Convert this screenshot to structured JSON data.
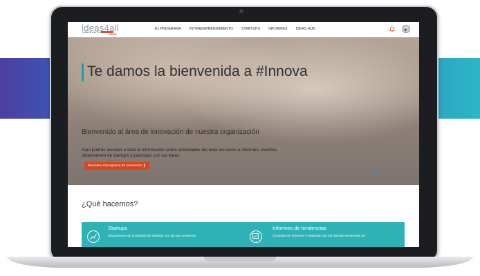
{
  "nav": {
    "logo": {
      "main": "ideas4all",
      "sub": "INNOVATION",
      "tag": "DEMO"
    },
    "links": [
      "EL PROGRAMA",
      "INTRAEMPRENDIMIENTO",
      "STARTUPS",
      "INFORMES",
      "IDEAS HUB"
    ]
  },
  "hero": {
    "title": "Te damos la bienvenida a #Innova",
    "subtitle": "Bienvenido al área de innovación de nuestra organización",
    "description": "Aquí podrás acceder a toda la información sobre actividades del área así como a informes, eventos, observatorio de startups y participar con tus ideas",
    "button_label": "Descubre el programa de innovación ❯"
  },
  "section": {
    "title": "¿Qué hacemos?"
  },
  "cards": [
    {
      "title": "Startups",
      "description": "Disponemos de un listado de startups con las que podemos"
    },
    {
      "title": "Informes de tendencias",
      "description": "Consulta los informes e inspírate con las últimas tendencias de"
    }
  ],
  "colors": {
    "accent": "#1a9db1",
    "button": "#d6471f",
    "band": "#2fb2b6",
    "side_left": "#4b3fa0",
    "side_right": "#2db6c7"
  },
  "icons": [
    "bell-icon",
    "avatar",
    "arrow-down-icon",
    "startup-icon",
    "report-icon"
  ]
}
